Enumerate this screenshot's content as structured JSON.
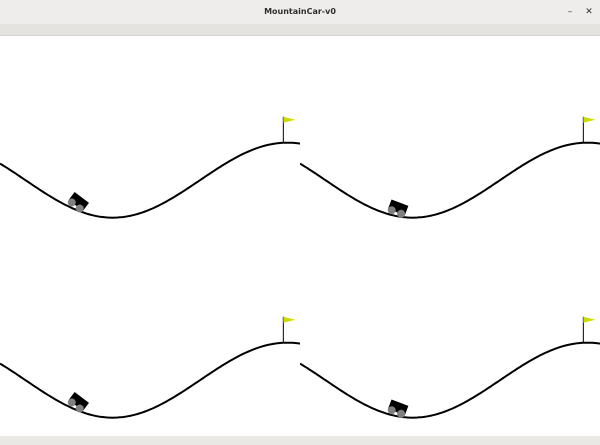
{
  "window": {
    "title": "MountainCar-v0",
    "minimize_glyph": "–",
    "close_glyph": "✕"
  },
  "colors": {
    "flag": "#ccdb00",
    "track": "#000000",
    "car_body": "#000000",
    "wheel": "#808080"
  },
  "environments": [
    {
      "id": "env-1",
      "car_position": -0.76
    },
    {
      "id": "env-2",
      "car_position": -0.63
    },
    {
      "id": "env-3",
      "car_position": -0.76
    },
    {
      "id": "env-4",
      "car_position": -0.63
    }
  ]
}
